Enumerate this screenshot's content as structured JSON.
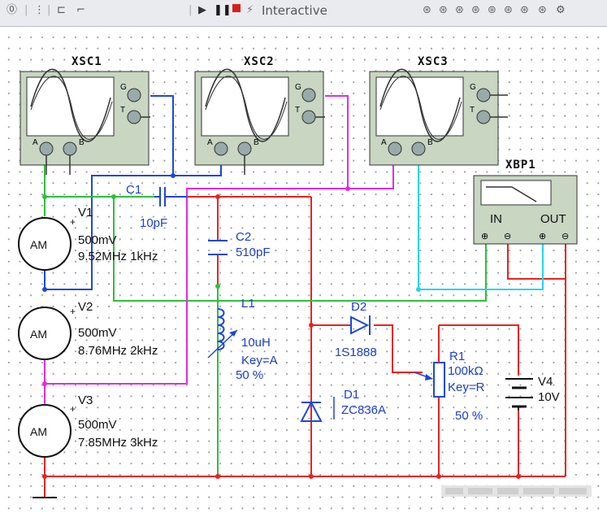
{
  "toolbar": {
    "mode_label": "Interactive",
    "colors": {
      "pause": "#1a1a1a",
      "stop": "#d81f1f"
    }
  },
  "scopes": [
    {
      "ref": "XSC1",
      "g": "G",
      "t": "T",
      "a": "A",
      "b": "B"
    },
    {
      "ref": "XSC2",
      "g": "G",
      "t": "T",
      "a": "A",
      "b": "B"
    },
    {
      "ref": "XSC3",
      "g": "G",
      "t": "T",
      "a": "A",
      "b": "B"
    }
  ],
  "bode": {
    "ref": "XBP1",
    "in": "IN",
    "out": "OUT"
  },
  "sources": [
    {
      "ref": "V1",
      "sym": "AM",
      "amp": "500mV",
      "freq": "9.52MHz 1kHz"
    },
    {
      "ref": "V2",
      "sym": "AM",
      "amp": "500mV",
      "freq": "8.76MHz 2kHz"
    },
    {
      "ref": "V3",
      "sym": "AM",
      "amp": "500mV",
      "freq": "7.85MHz 3kHz"
    }
  ],
  "c1": {
    "ref": "C1",
    "val": "10pF"
  },
  "c2": {
    "ref": "C2",
    "val": "510pF"
  },
  "l1": {
    "ref": "L1",
    "val": "10uH",
    "key": "Key=A",
    "pct": "50 %"
  },
  "d2": {
    "ref": "D2",
    "model": "1S1888"
  },
  "d1": {
    "ref": "D1",
    "model": "ZC836A"
  },
  "r1": {
    "ref": "R1",
    "val": "100kΩ",
    "key": "Key=R",
    "pct": "50 %"
  },
  "v4": {
    "ref": "V4",
    "val": "10V"
  },
  "plus": "+",
  "wire_colors": {
    "red": "#e8231f",
    "blue": "#1f47d8",
    "green": "#2fbf3a",
    "magenta": "#e22ce0",
    "cyan": "#25d6e6"
  }
}
